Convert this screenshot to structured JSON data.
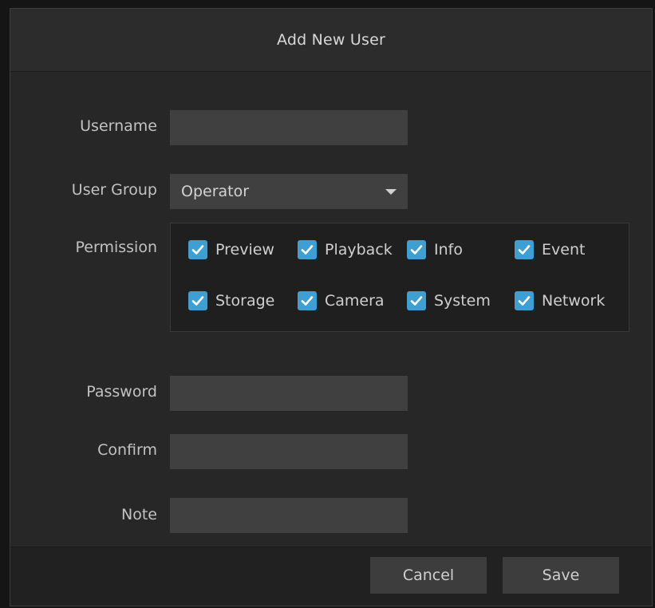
{
  "dialog": {
    "title": "Add New User"
  },
  "form": {
    "username": {
      "label": "Username",
      "value": "",
      "placeholder": ""
    },
    "user_group": {
      "label": "User Group",
      "value": "Operator"
    },
    "permission": {
      "label": "Permission",
      "items": [
        {
          "label": "Preview",
          "checked": true
        },
        {
          "label": "Playback",
          "checked": true
        },
        {
          "label": "Info",
          "checked": true
        },
        {
          "label": "Event",
          "checked": true
        },
        {
          "label": "Storage",
          "checked": true
        },
        {
          "label": "Camera",
          "checked": true
        },
        {
          "label": "System",
          "checked": true
        },
        {
          "label": "Network",
          "checked": true
        }
      ]
    },
    "password": {
      "label": "Password",
      "value": ""
    },
    "confirm": {
      "label": "Confirm",
      "value": ""
    },
    "note": {
      "label": "Note",
      "value": ""
    }
  },
  "footer": {
    "cancel_label": "Cancel",
    "save_label": "Save"
  },
  "colors": {
    "accent": "#3ea0d2",
    "dialog_bg": "#2a2a2a",
    "field_bg": "#404040"
  },
  "icons": {
    "checkbox": "check-icon",
    "dropdown": "chevron-down-icon"
  }
}
